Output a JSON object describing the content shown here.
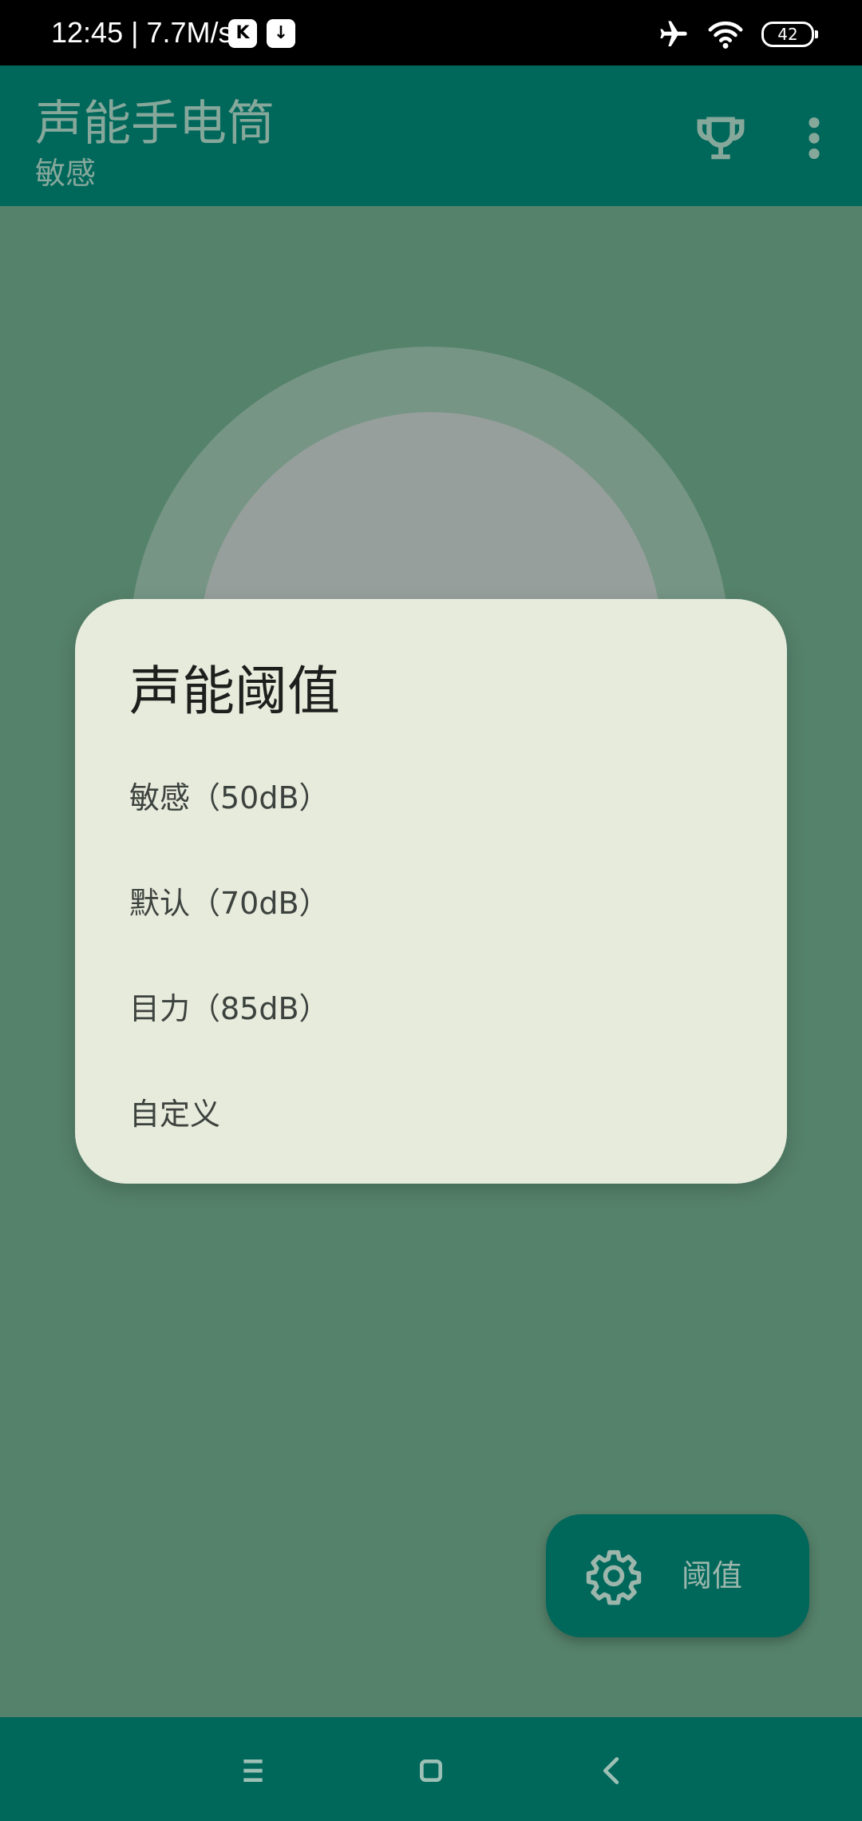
{
  "status_bar": {
    "time": "12:45 | 7.7M/s",
    "app_icon_1": "K",
    "app_icon_2": "↓",
    "battery": "42",
    "icons": [
      "airplane-mode-icon",
      "wifi-icon",
      "battery-icon"
    ]
  },
  "app_bar": {
    "title": "声能手电筒",
    "subtitle": "敏感",
    "actions": [
      "trophy-icon",
      "more-vert-icon"
    ]
  },
  "dialog": {
    "title": "声能阈值",
    "options": [
      {
        "label": "敏感（50dB）"
      },
      {
        "label": "默认（70dB）"
      },
      {
        "label": "目力（85dB）"
      },
      {
        "label": "自定义"
      }
    ]
  },
  "fab": {
    "icon": "gear-icon",
    "label": "阈值"
  },
  "nav_bar": {
    "buttons": [
      "menu-icon",
      "home-icon",
      "back-icon"
    ]
  },
  "colors": {
    "app_bar": "#00675b",
    "scrim_background": "#55826b",
    "dialog_surface": "#e6ebdc",
    "fab": "#00675b"
  }
}
